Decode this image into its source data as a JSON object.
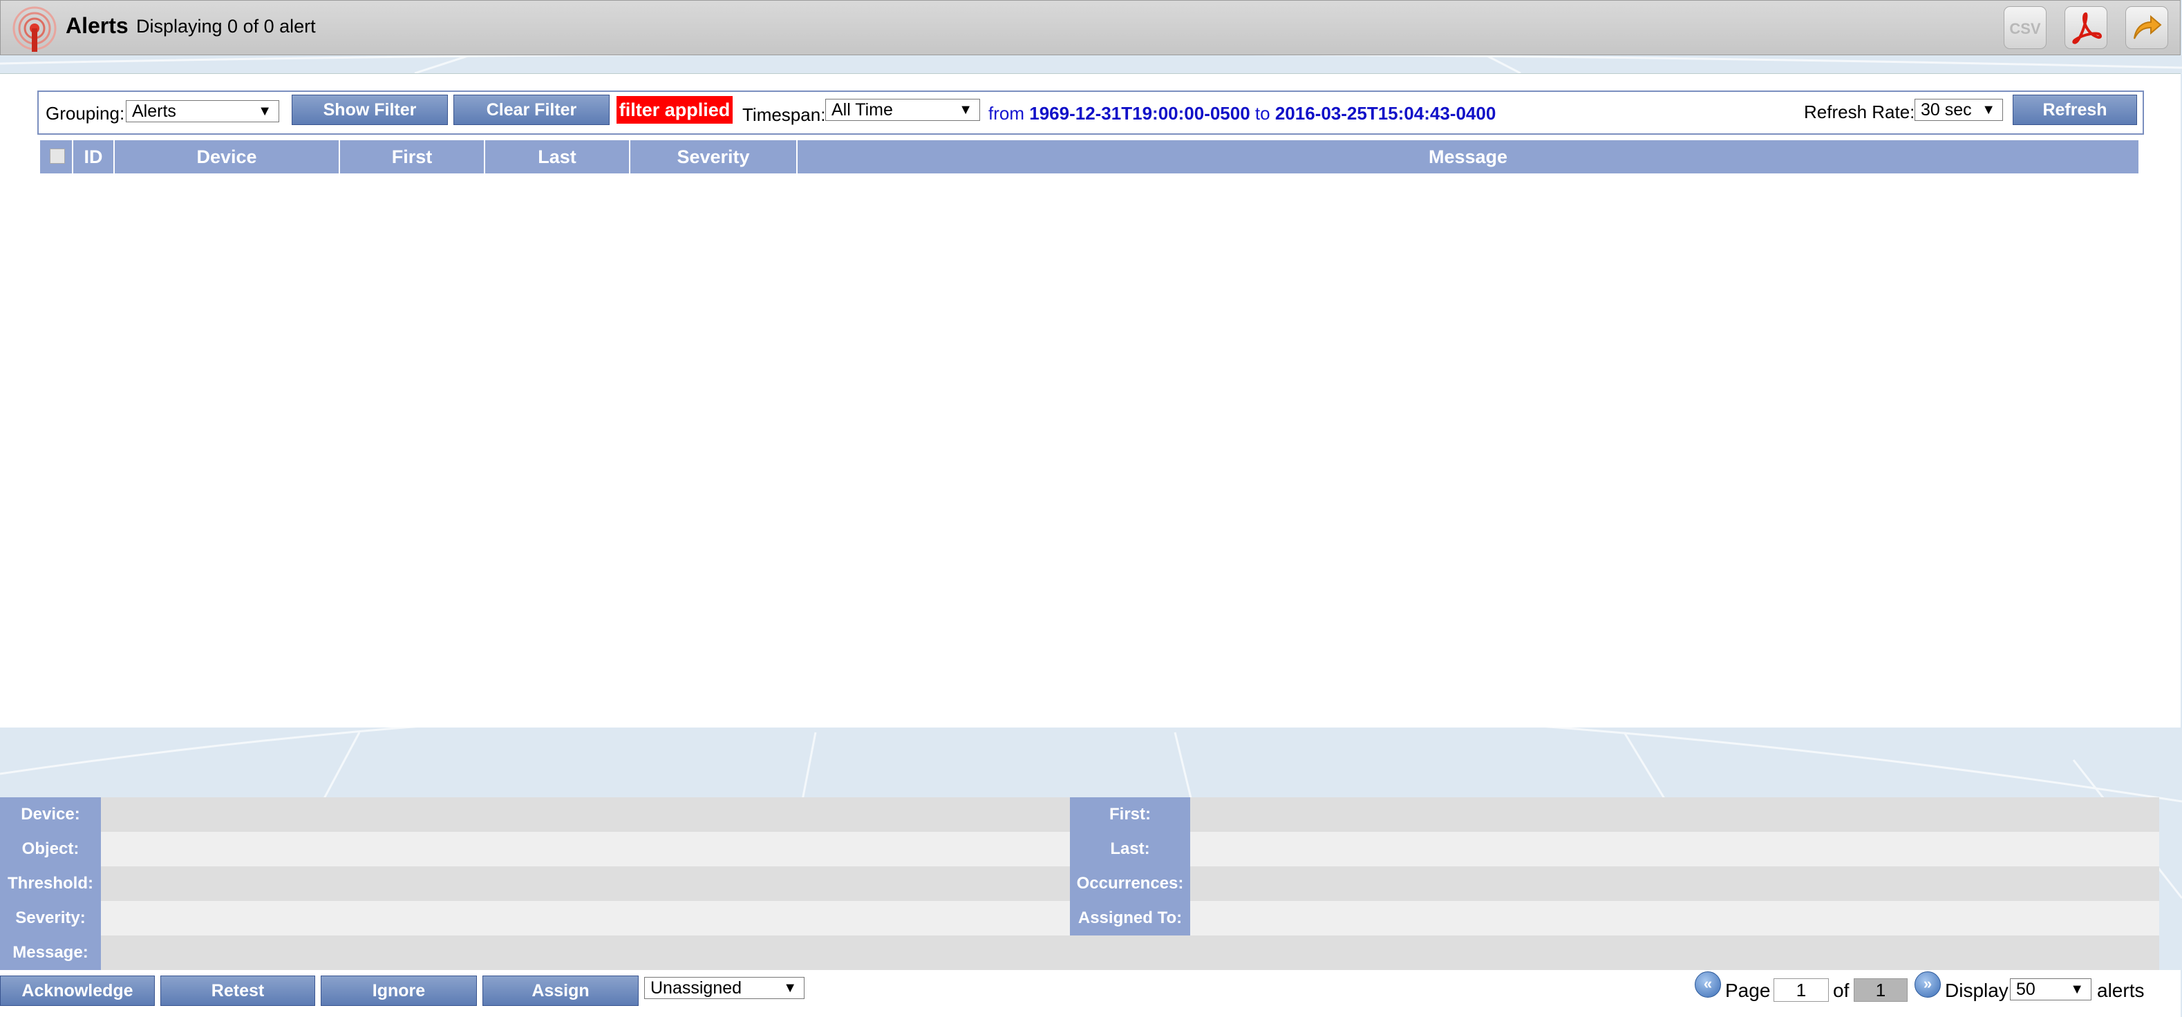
{
  "header": {
    "title": "Alerts",
    "count_text": "Displaying 0 of 0 alert",
    "csv_label": "CSV"
  },
  "toolbar": {
    "grouping_label": "Grouping:",
    "grouping_value": "Alerts",
    "show_filter": "Show Filter",
    "clear_filter": "Clear Filter",
    "filter_applied": "filter applied",
    "timespan_label": "Timespan:",
    "timespan_value": "All Time",
    "from_label": "from",
    "from_value": "1969-12-31T19:00:00-0500",
    "to_label": "to",
    "to_value": "2016-03-25T15:04:43-0400",
    "refresh_rate_label": "Refresh Rate:",
    "refresh_rate_value": "30 sec",
    "refresh": "Refresh"
  },
  "table": {
    "columns": [
      "ID",
      "Device",
      "First",
      "Last",
      "Severity",
      "Message"
    ]
  },
  "details": {
    "device": "Device:",
    "object": "Object:",
    "threshold": "Threshold:",
    "severity": "Severity:",
    "message": "Message:",
    "first": "First:",
    "last": "Last:",
    "occurrences": "Occurrences:",
    "assigned_to": "Assigned To:"
  },
  "actions": {
    "acknowledge": "Acknowledge",
    "retest": "Retest",
    "ignore": "Ignore",
    "assign": "Assign",
    "assign_value": "Unassigned"
  },
  "pager": {
    "page_label": "Page",
    "page_value": "1",
    "of_label": "of",
    "total_pages": "1",
    "display_label": "Display",
    "display_value": "50",
    "alerts_label": "alerts"
  },
  "colors": {
    "header_blue": "#8fa3d1",
    "button_blue": "#5d7cb4",
    "filter_red": "#ff0000",
    "link_blue": "#1010c8"
  }
}
